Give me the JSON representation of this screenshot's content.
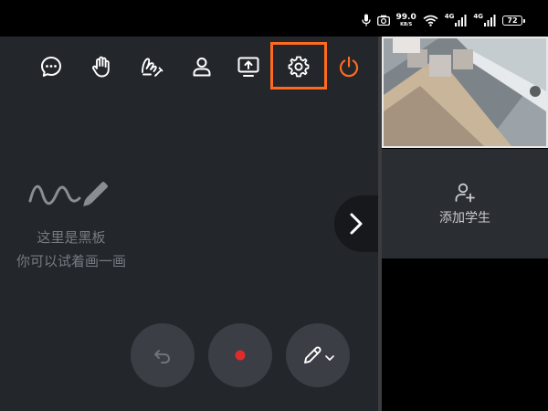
{
  "status_bar": {
    "speed_value": "99.0",
    "speed_unit": "KB/S",
    "network_1": "4G",
    "network_2": "4G",
    "battery": "72",
    "icons": [
      "microphone-icon",
      "camera-icon",
      "wifi-icon",
      "signal-icon",
      "signal-icon",
      "battery-icon"
    ]
  },
  "toolbar": {
    "buttons": [
      "chat-icon",
      "raise-hand-icon",
      "gesture-icon",
      "user-icon",
      "screen-share-icon",
      "settings-icon",
      "power-icon"
    ],
    "highlighted": "settings-icon",
    "accent_color": "#ff6a1f"
  },
  "board": {
    "hint_line1": "这里是黑板",
    "hint_line2": "你可以试着画一画"
  },
  "side_panel": {
    "add_student_label": "添加学生"
  },
  "bottom_controls": [
    "undo-icon",
    "record-icon",
    "pen-icon"
  ],
  "colors": {
    "board_bg": "#23262b",
    "record": "#e02b2b",
    "power": "#ff6a1f"
  }
}
